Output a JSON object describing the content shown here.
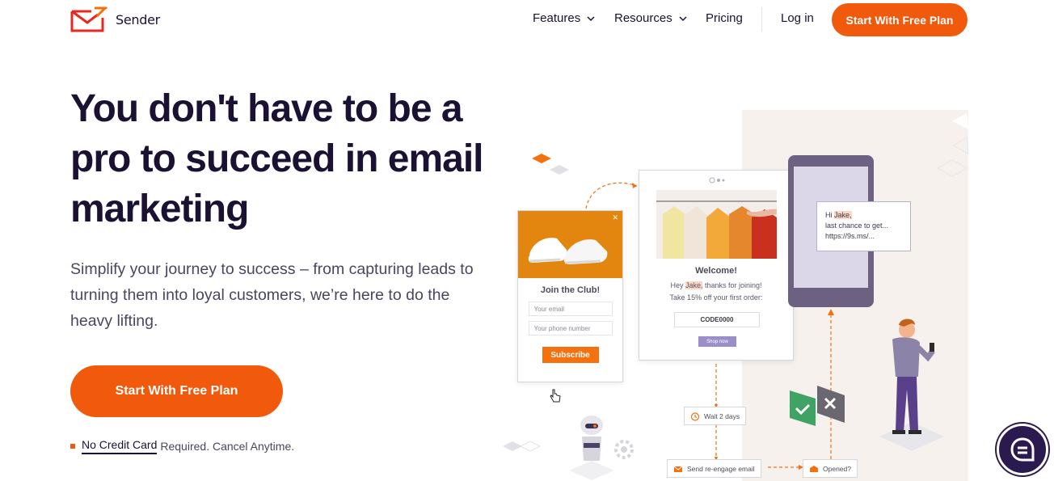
{
  "header": {
    "brand": "Sender",
    "nav": {
      "features": "Features",
      "resources": "Resources",
      "pricing": "Pricing",
      "login": "Log in"
    },
    "cta": "Start With Free Plan"
  },
  "hero": {
    "headline": "You don't have to be a pro to succeed in email marketing",
    "subtext": "Simplify your journey to success – from capturing leads to turning them into loyal customers, we’re here to do the heavy lifting.",
    "cta": "Start With Free Plan",
    "note_strong": "No Credit Card",
    "note_rest": "Required. Cancel Anytime."
  },
  "illustration": {
    "club_card": {
      "title": "Join the Club!",
      "email_placeholder": "Your email",
      "phone_placeholder": "Your phone number",
      "button": "Subscribe"
    },
    "welcome_card": {
      "title": "Welcome!",
      "line1_prefix": "Hey ",
      "name": "Jake,",
      "line1_suffix": " thanks for joining!",
      "line2": "Take 15% off your first order:",
      "code": "CODE0000",
      "button": "Shop now"
    },
    "sms_bubble": {
      "greeting_prefix": "Hi ",
      "name": "Jake,",
      "line2": "last chance to get...",
      "line3": "https://9s.ms/..."
    },
    "flow": {
      "wait": "Wait 2 days",
      "reengage": "Send re-engage email",
      "opened": "Opened?"
    }
  },
  "colors": {
    "brand_orange": "#f15a0c",
    "ink": "#1b1133",
    "chat_bg": "#2a1a50"
  }
}
